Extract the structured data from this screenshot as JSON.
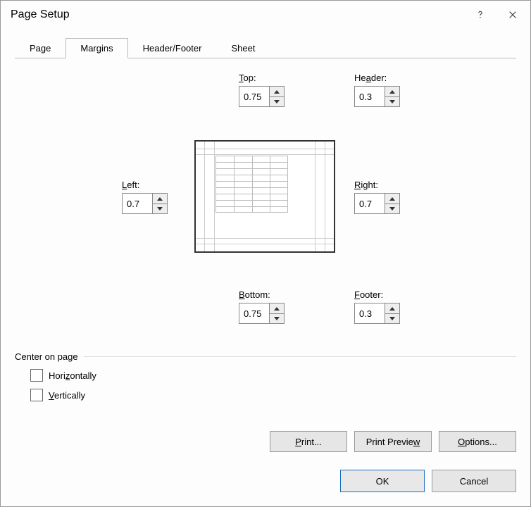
{
  "title": "Page Setup",
  "tabs": {
    "page": "Page",
    "margins": "Margins",
    "header_footer": "Header/Footer",
    "sheet": "Sheet"
  },
  "margins": {
    "top_label": "Top:",
    "top_value": "0.75",
    "header_label": "Header:",
    "header_value": "0.3",
    "left_label": "Left:",
    "left_value": "0.7",
    "right_label": "Right:",
    "right_value": "0.7",
    "bottom_label": "Bottom:",
    "bottom_value": "0.75",
    "footer_label": "Footer:",
    "footer_value": "0.3"
  },
  "center_group": {
    "label": "Center on page",
    "horizontally_label": "Horizontally",
    "vertically_label": "Vertically",
    "horizontally_checked": false,
    "vertically_checked": false
  },
  "buttons": {
    "print": "Print...",
    "print_preview": "Print Preview",
    "options": "Options...",
    "ok": "OK",
    "cancel": "Cancel"
  },
  "underline_hints": {
    "top": "T",
    "header": "A",
    "left": "L",
    "right": "R",
    "bottom": "B",
    "footer": "F",
    "horizontally": "Z",
    "vertically": "V",
    "print": "P",
    "preview": "W",
    "options": "O"
  }
}
